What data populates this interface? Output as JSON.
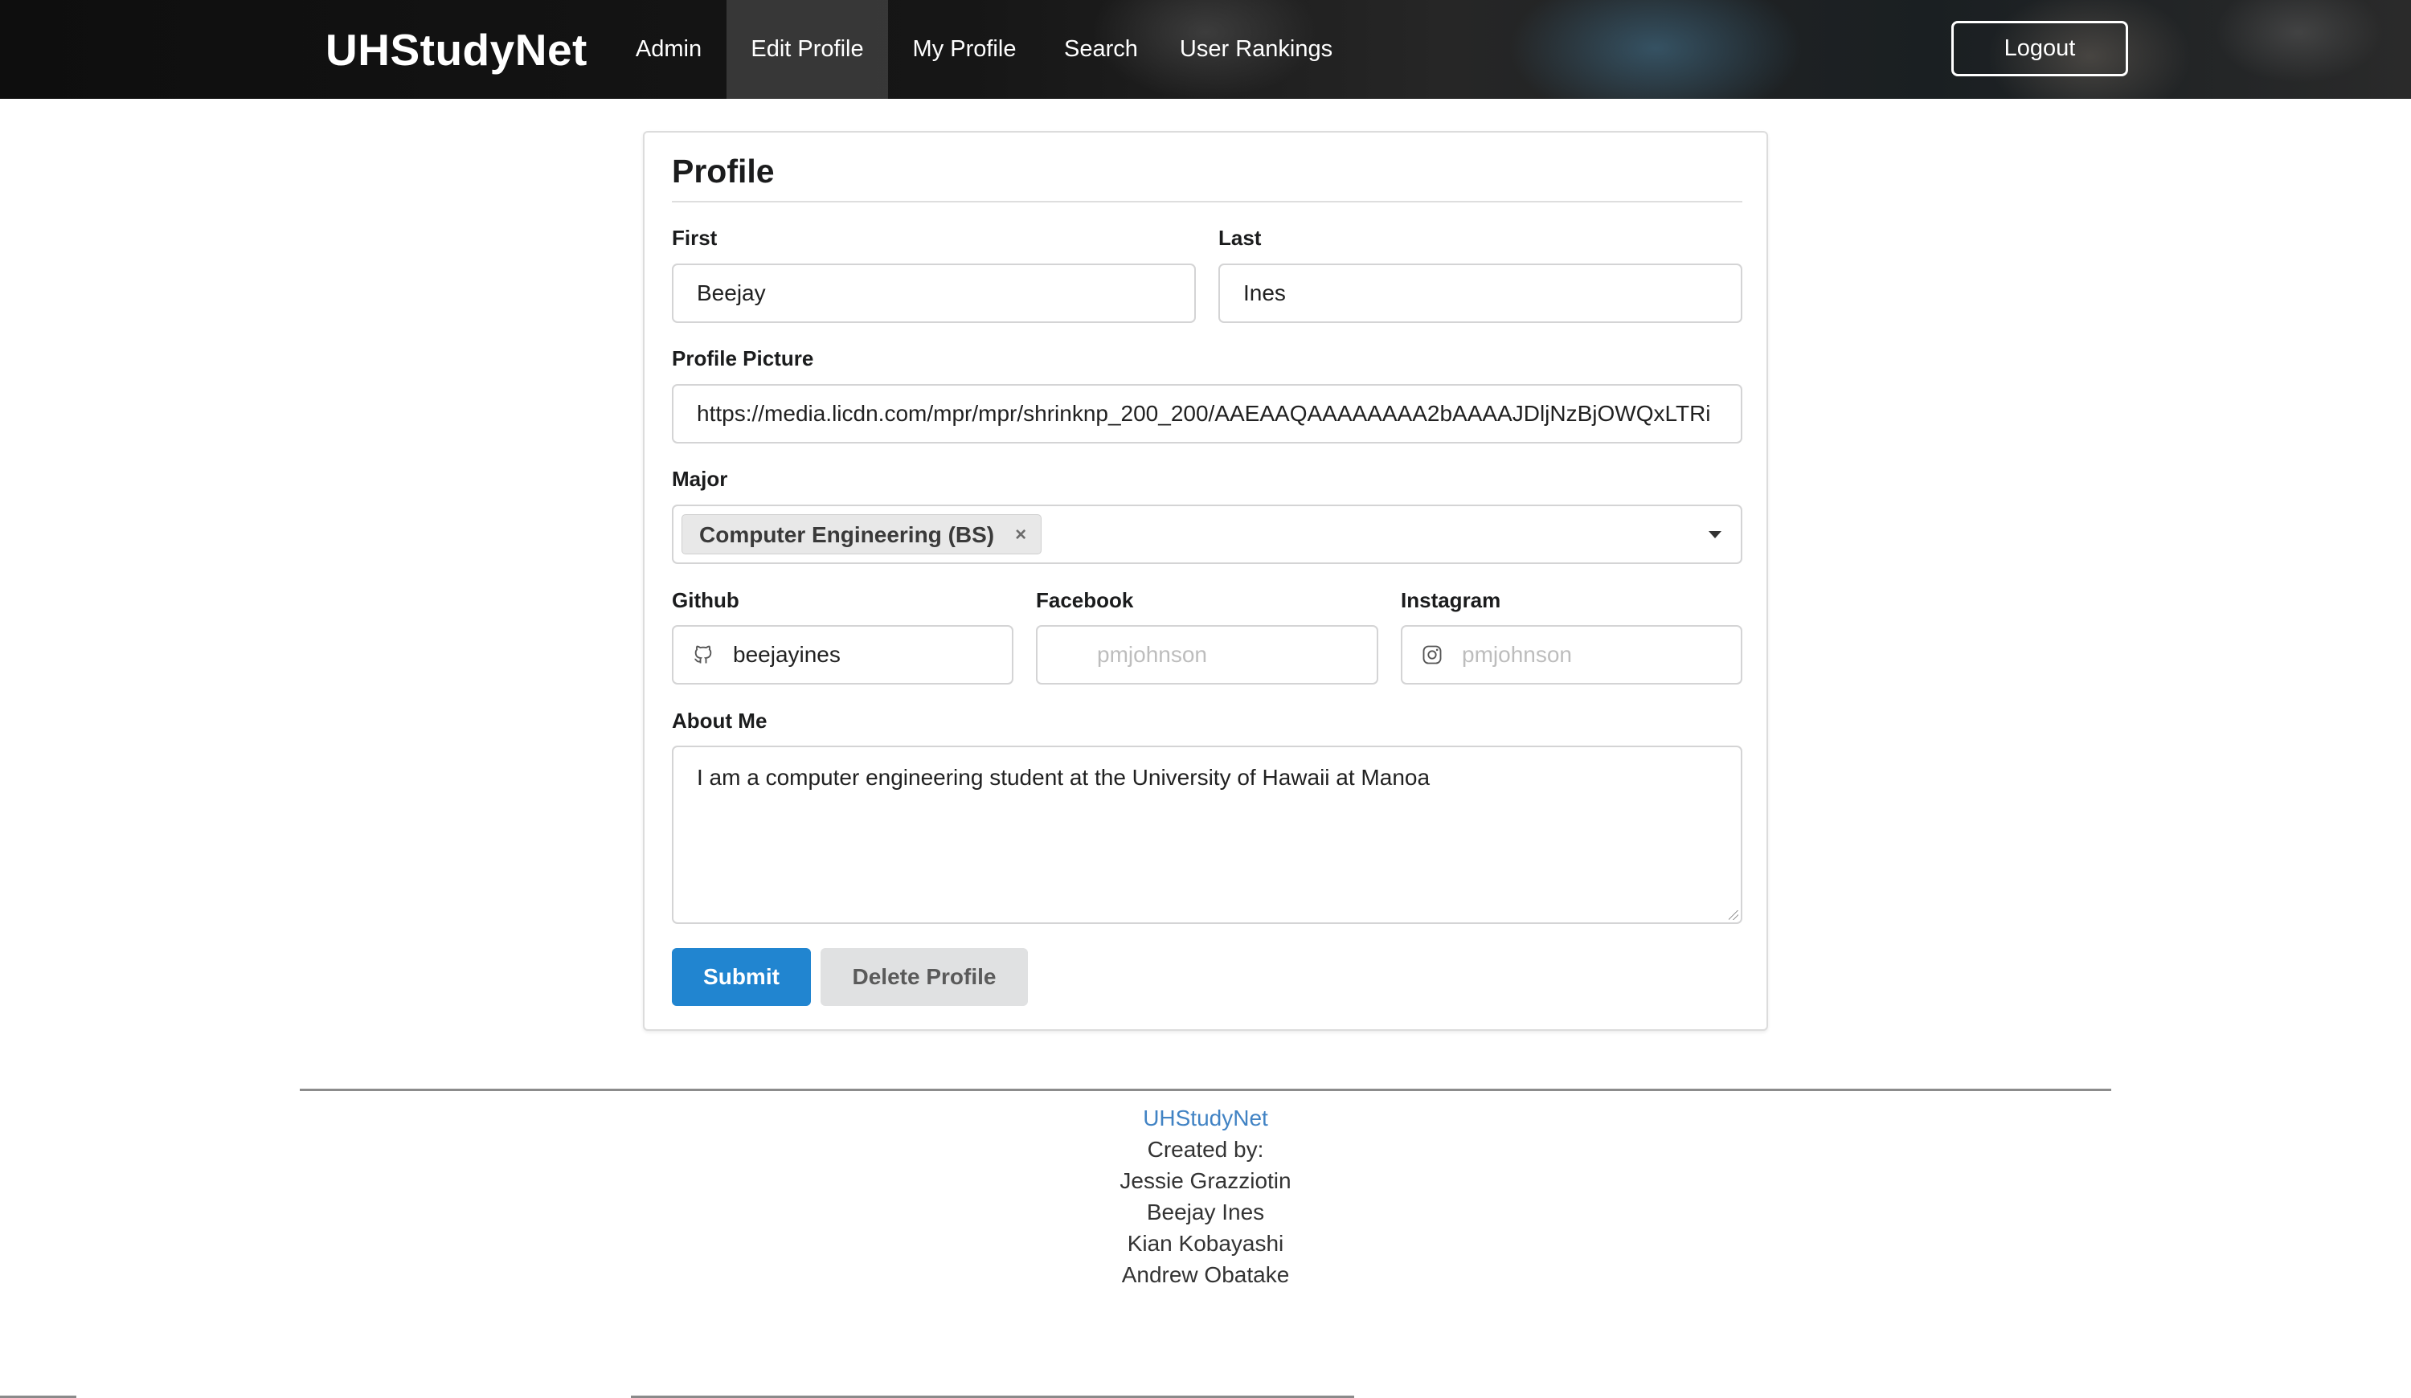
{
  "navbar": {
    "brand": "UHStudyNet",
    "items": [
      {
        "label": "Admin",
        "active": false
      },
      {
        "label": "Edit Profile",
        "active": true
      },
      {
        "label": "My Profile",
        "active": false
      },
      {
        "label": "Search",
        "active": false
      },
      {
        "label": "User Rankings",
        "active": false
      }
    ],
    "logout_label": "Logout"
  },
  "form": {
    "title": "Profile",
    "first": {
      "label": "First",
      "value": "Beejay"
    },
    "last": {
      "label": "Last",
      "value": "Ines"
    },
    "picture": {
      "label": "Profile Picture",
      "value": "https://media.licdn.com/mpr/mpr/shrinknp_200_200/AAEAAQAAAAAAAA2bAAAAJDljNzBjOWQxLTRi"
    },
    "major": {
      "label": "Major",
      "selected": "Computer Engineering (BS)",
      "remove_glyph": "×"
    },
    "github": {
      "label": "Github",
      "value": "beejayines",
      "icon": "github-icon"
    },
    "facebook": {
      "label": "Facebook",
      "placeholder": "pmjohnson",
      "icon": "facebook-icon"
    },
    "instagram": {
      "label": "Instagram",
      "placeholder": "pmjohnson",
      "icon": "instagram-icon"
    },
    "about": {
      "label": "About Me",
      "value": "I am a computer engineering student at the University of Hawaii at Manoa"
    },
    "submit_label": "Submit",
    "delete_label": "Delete Profile"
  },
  "footer": {
    "link": "UHStudyNet",
    "created_by": "Created by:",
    "authors": [
      "Jessie Grazziotin",
      "Beejay Ines",
      "Kian Kobayashi",
      "Andrew Obatake"
    ]
  },
  "colors": {
    "primary": "#2185d0",
    "link": "#4183c4",
    "navbar_bg": "#151515"
  }
}
